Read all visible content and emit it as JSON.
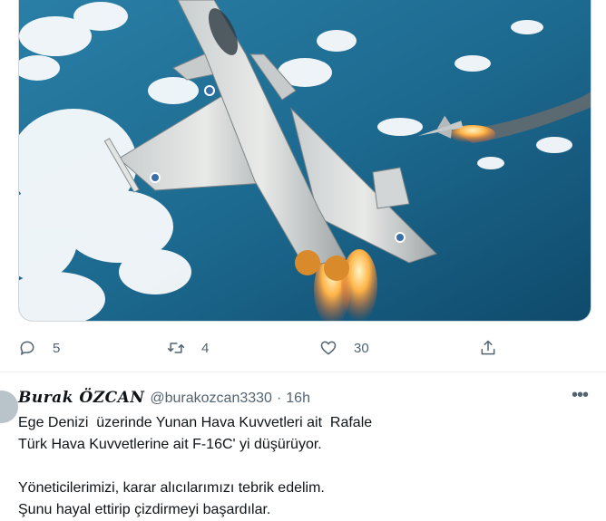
{
  "tweet_actions": {
    "reply_count": "5",
    "retweet_count": "4",
    "like_count": "30",
    "icons": [
      "reply-icon",
      "retweet-icon",
      "like-icon",
      "share-icon"
    ]
  },
  "next_tweet": {
    "display_name": "Burak ÖZCAN",
    "handle": "@burakozcan3330",
    "separator": "·",
    "time": "16h",
    "more_label": "•••",
    "lines": [
      "Ege Denizi  üzerinde Yunan Hava Kuvvetleri ait  Rafale",
      "Türk Hava Kuvvetlerine ait F-16C' yi düşürüyor.",
      "Yöneticilerimizi, karar alıcılarımızı tebrik edelim.",
      "Şunu hayal ettirip çizdirmeyi başardılar."
    ]
  },
  "colors": {
    "text_primary": "#0f1419",
    "text_secondary": "#536471",
    "divider": "#eff3f4"
  }
}
